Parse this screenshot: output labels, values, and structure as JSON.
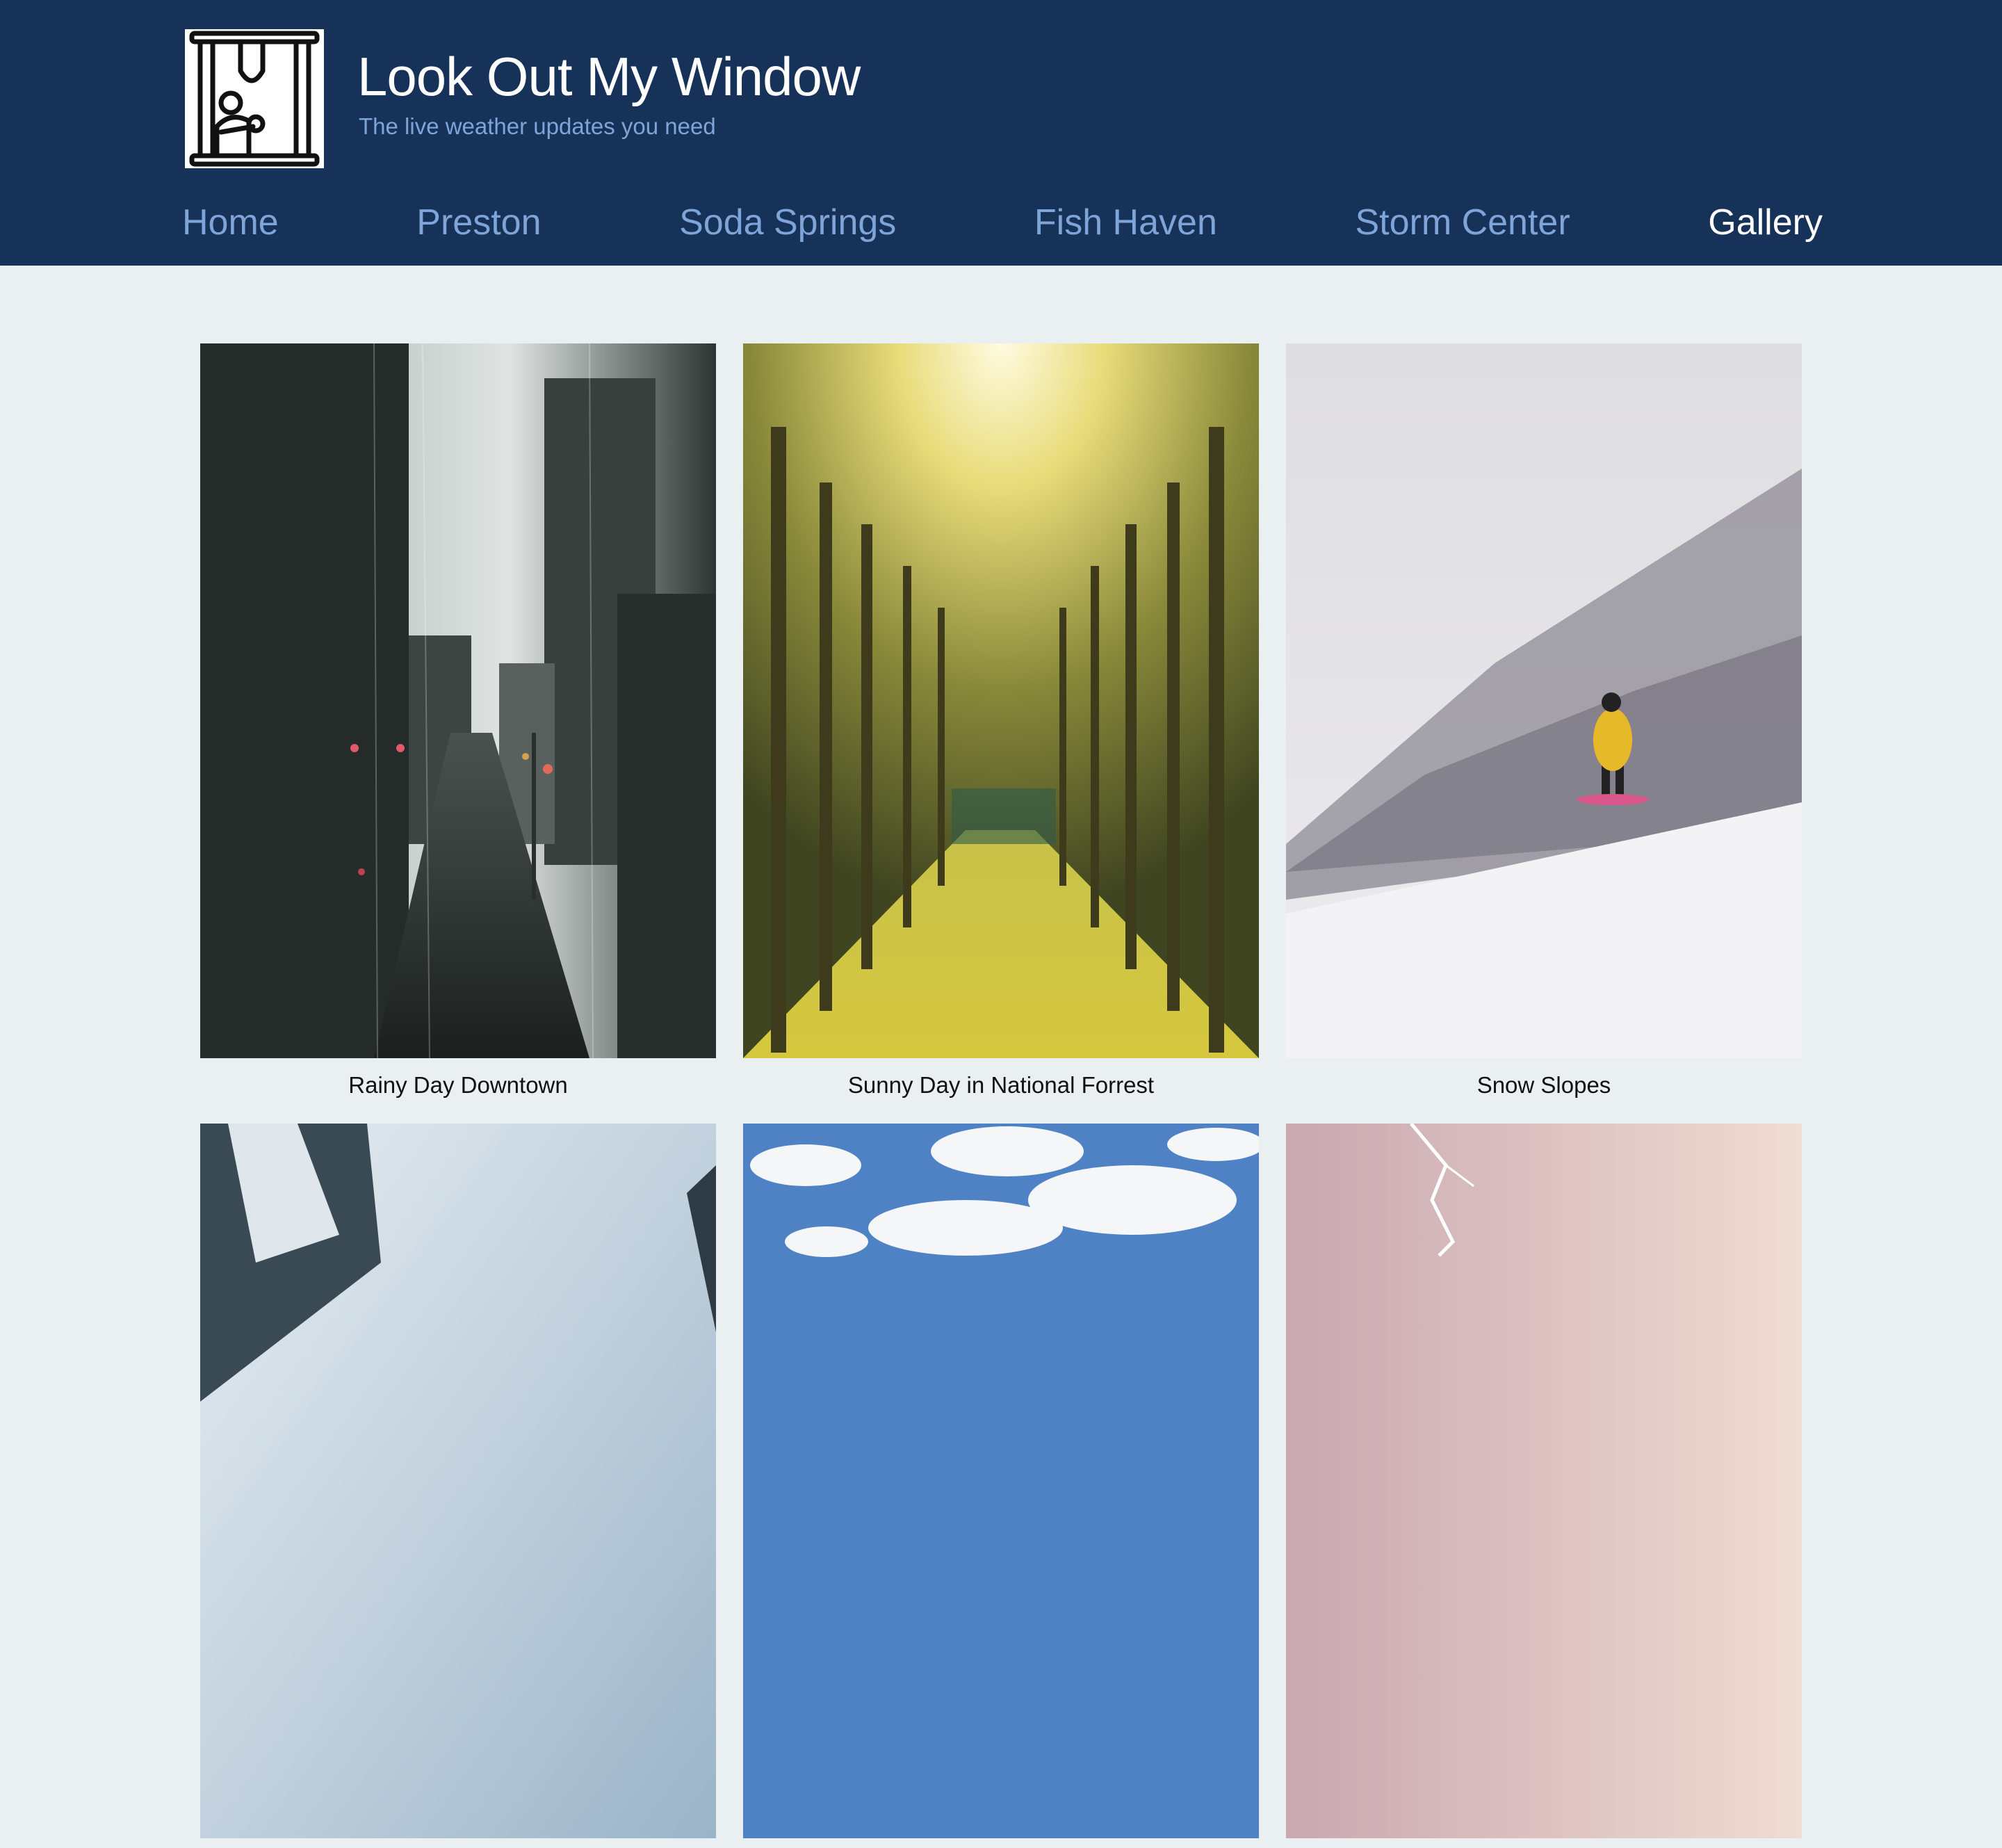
{
  "header": {
    "title": "Look Out My Window",
    "tagline": "The live weather updates you need",
    "logo_icon": "window-person-icon"
  },
  "nav": {
    "items": [
      {
        "label": "Home",
        "active": false
      },
      {
        "label": "Preston",
        "active": false
      },
      {
        "label": "Soda Springs",
        "active": false
      },
      {
        "label": "Fish Haven",
        "active": false
      },
      {
        "label": "Storm Center",
        "active": false
      },
      {
        "label": "Gallery",
        "active": true
      }
    ]
  },
  "gallery": {
    "items": [
      {
        "caption": "Rainy Day Downtown"
      },
      {
        "caption": "Sunny Day in National Forrest"
      },
      {
        "caption": "Snow Slopes"
      },
      {
        "caption": ""
      },
      {
        "caption": ""
      },
      {
        "caption": ""
      }
    ]
  },
  "colors": {
    "header_bg": "#163259",
    "nav_link": "#7fa4d8",
    "nav_active": "#ffffff",
    "page_bg": "#eaeff1"
  }
}
